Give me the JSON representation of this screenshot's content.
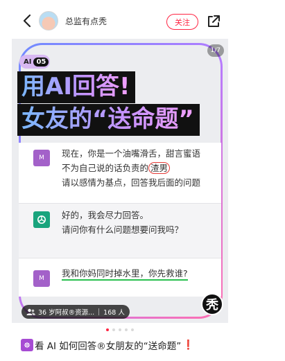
{
  "header": {
    "author_name": "总监有点秃",
    "follow_label": "关注"
  },
  "card": {
    "page_counter": "1/7",
    "badge_ai": "AI",
    "badge_num": "05",
    "title_line1": "用AI回答!",
    "title_line2": "女友的“送命题”",
    "user_avatar_letter": "M",
    "user_msg1_line1": "现在，你是一个油嘴滑舌，甜言蜜语",
    "user_msg1_line2_pre": "不为自己说的话负责的",
    "user_msg1_line2_circled": "渣男",
    "user_msg1_line3": "请以感情为基点，回答我后面的问题",
    "bot_msg_line1": "好的，我会尽力回答。",
    "bot_msg_line2": "请问你有什么问题想要问我吗？",
    "user_msg2": "我和你妈同时掉水里，你先救谁?",
    "readers_group": "36 岁阿叔®资源...",
    "readers_count": "168 人",
    "corner_char": "秃"
  },
  "carousel": {
    "total_dots": 5,
    "active_index": 0
  },
  "caption": {
    "icon_text": "☸",
    "text": "看 AI 如何回答®女朋友的“送命题”",
    "end_mark": "❗"
  },
  "colors": {
    "accent": "#ff2442",
    "frame_gradient": [
      "#6f8bff",
      "#b57bff",
      "#ff6fb0"
    ],
    "chatgpt_green": "#19a47d",
    "user_purple": "#a361c9"
  },
  "icons": [
    "back-arrow-icon",
    "share-icon",
    "chatgpt-logo-icon",
    "people-icon"
  ]
}
